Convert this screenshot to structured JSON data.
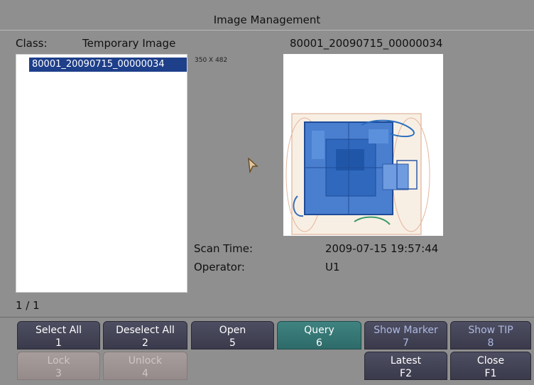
{
  "window": {
    "title": "Image Management"
  },
  "class_row": {
    "label": "Class:",
    "value": "Temporary Image",
    "selected_image_name": "80001_20090715_00000034"
  },
  "image_list": {
    "items": [
      {
        "label": "80001_20090715_00000034",
        "selected": true
      }
    ],
    "page_counter": "1 / 1"
  },
  "preview": {
    "dimensions_label": "350 X 482"
  },
  "details": {
    "scan_time_label": "Scan Time:",
    "scan_time_value": "2009-07-15 19:57:44",
    "operator_label": "Operator:",
    "operator_value": "U1"
  },
  "buttons": {
    "select_all": {
      "label": "Select All",
      "key": "1"
    },
    "deselect_all": {
      "label": "Deselect All",
      "key": "2"
    },
    "open": {
      "label": "Open",
      "key": "5"
    },
    "query": {
      "label": "Query",
      "key": "6"
    },
    "show_marker": {
      "label": "Show Marker",
      "key": "7"
    },
    "show_tip": {
      "label": "Show TIP",
      "key": "8"
    },
    "lock": {
      "label": "Lock",
      "key": "3"
    },
    "unlock": {
      "label": "Unlock",
      "key": "4"
    },
    "latest": {
      "label": "Latest",
      "key": "F2"
    },
    "close": {
      "label": "Close",
      "key": "F1"
    }
  },
  "colors": {
    "background": "#8f8f8f",
    "selection": "#1e3f8a",
    "button": "#44445a",
    "active_button": "#3a7a78",
    "disabled_button": "#a0a0a0"
  }
}
